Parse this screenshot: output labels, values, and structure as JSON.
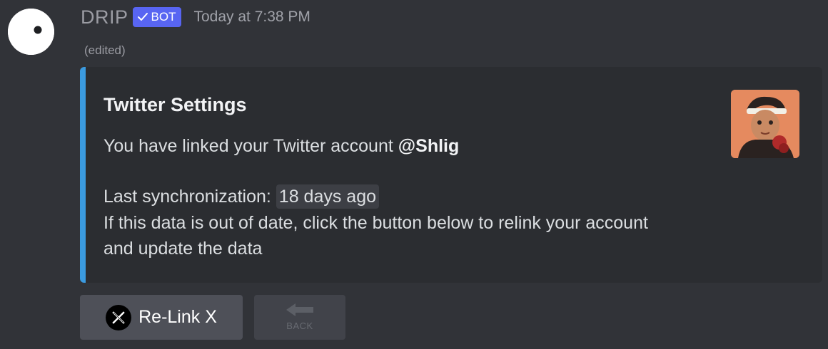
{
  "message": {
    "author": "DRIP",
    "bot_badge": "BOT",
    "timestamp": "Today at 7:38 PM",
    "edited": "(edited)"
  },
  "embed": {
    "accent_color": "#3b9be0",
    "title": "Twitter Settings",
    "linked_prefix": "You have linked your Twitter account ",
    "handle": "@Shlig",
    "sync_prefix": "Last synchronization: ",
    "sync_value": "18 days ago",
    "info_line_1": "If this data is out of date, click the button below to relink your account",
    "info_line_2": "and update the data"
  },
  "buttons": {
    "relink_label": "Re-Link X",
    "back_label": "BACK"
  },
  "icons": {
    "avatar": "drip-logo-icon",
    "badge_check": "check-icon",
    "x_logo": "x-logo-icon",
    "back_arrow": "back-arrow-icon",
    "thumbnail": "profile-picture"
  },
  "colors": {
    "background": "#313338",
    "embed_bg": "#2b2d31",
    "badge": "#5865f2",
    "button": "#4e5058"
  }
}
